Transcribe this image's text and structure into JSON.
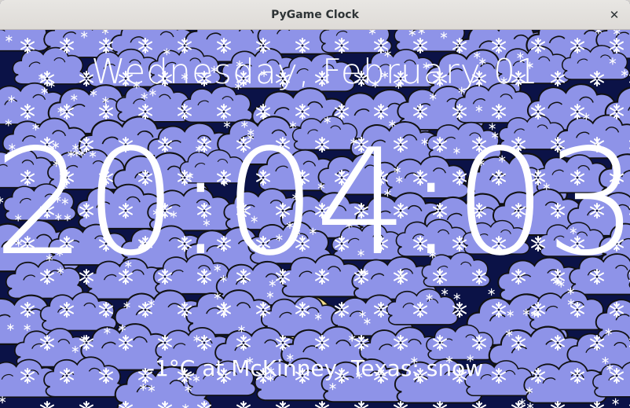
{
  "window": {
    "title": "PyGame Clock",
    "close_icon": "close-icon"
  },
  "clock": {
    "date": "Wednesday, February 01",
    "time": "20:04:03",
    "weather": "-1°C at McKinney, Texas: snow"
  },
  "colors": {
    "sky": "#0b1247",
    "cloud": "#8e93e8",
    "cloud_outline": "#111111",
    "snowflake": "#ffffff",
    "sun": "#f3dc8b",
    "text": "#ffffff"
  },
  "scene": {
    "background_icons": [
      "cloud-icon",
      "snowflake-icon",
      "sun-icon"
    ]
  }
}
